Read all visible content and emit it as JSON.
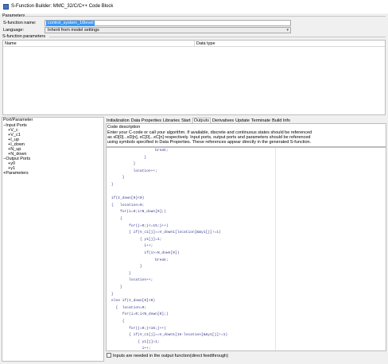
{
  "window": {
    "title": "S-Function Builder: MMC_32/C/C++ Code Block"
  },
  "parameters_group": {
    "label": "Parameters",
    "sfunction_name_label": "S-function name:",
    "sfunction_name_value": "control_system_16level",
    "language_label": "Language:",
    "language_value": "Inherit from model settings"
  },
  "sfun_params": {
    "label": "S-function parameters",
    "col_name": "Name",
    "col_type": "Data type"
  },
  "ports": {
    "label": "Port/Parameter",
    "tree": [
      {
        "text": "−Input Ports",
        "indent": 0
      },
      {
        "text": "+V_c",
        "indent": 1
      },
      {
        "text": "+V_c1",
        "indent": 1
      },
      {
        "text": "+I_up",
        "indent": 1
      },
      {
        "text": "+I_down",
        "indent": 1
      },
      {
        "text": "+N_up",
        "indent": 1
      },
      {
        "text": "+N_down",
        "indent": 1
      },
      {
        "text": "−Output Ports",
        "indent": 0
      },
      {
        "text": "+y0",
        "indent": 1
      },
      {
        "text": "+y1",
        "indent": 1
      },
      {
        "text": "+Parameters",
        "indent": 0
      }
    ]
  },
  "tabs": [
    "Initialization",
    "Data Properties",
    "Libraries",
    "Start",
    "Outputs",
    "Derivatives",
    "Update",
    "Terminate",
    "Build Info"
  ],
  "active_tab": "Outputs",
  "code_desc": {
    "label": "Code description",
    "line1": "Enter your C-code or call your algorithm. If available, discrete and continuous states should be referenced",
    "line2": "as xD[0]...xD[n], xC[0]...xC[n] respectively. Input ports, output ports and parameters should be referenced",
    "line3": "using symbols specified in Data Properties. These references appear directly in the generated S-function."
  },
  "code_lines": [
    "                    break;",
    "               }",
    "          }",
    "          location++;",
    "     }",
    "}",
    "",
    "if(I_down[0]<0)",
    "{   location=0;",
    "    for(i=0;i<N_down[0];)",
    "    {",
    "        for(j=0;j<=15;j++)",
    "        { if(V_c1[j]==V_down1[location]&&y1[j]!=1)",
    "             { y1[j]=1;",
    "               i++;",
    "               if(i>=N_down[0])",
    "                    break;",
    "             }",
    "        }",
    "        location++;",
    "    }",
    "}",
    "else if(I_down[0]<0)",
    "  {  location=0;",
    "     for(i=0;i<N_down[0];)",
    "     {",
    "        for(j=0;j<15;j++)",
    "        { if(V_c1[j]==V_down1[15-location]&&y1[j]!=1)",
    "            { y1[j]=1;",
    "              i++;"
  ],
  "feedthrough": {
    "label": "Inputs are needed in the output function(direct feedthrough)",
    "checked": false
  }
}
